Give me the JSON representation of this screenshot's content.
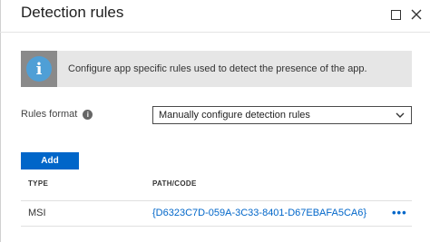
{
  "header": {
    "title": "Detection rules",
    "maximize_icon": "maximize-icon",
    "close_icon": "close-icon"
  },
  "banner": {
    "icon": "info-icon",
    "icon_glyph": "i",
    "text": "Configure app specific rules used to detect the presence of the app."
  },
  "rules_format": {
    "label": "Rules format",
    "help_glyph": "i",
    "selected": "Manually configure detection rules"
  },
  "add_button": {
    "label": "Add"
  },
  "table": {
    "columns": [
      "TYPE",
      "PATH/CODE"
    ],
    "rows": [
      {
        "type": "MSI",
        "path": "{D6323C7D-059A-3C33-8401-D67EBAFA5CA6}",
        "more": "•••"
      }
    ]
  },
  "colors": {
    "accent": "#0066c9",
    "info_blue": "#4f9fd6",
    "banner_bg": "#e6e6e6"
  }
}
